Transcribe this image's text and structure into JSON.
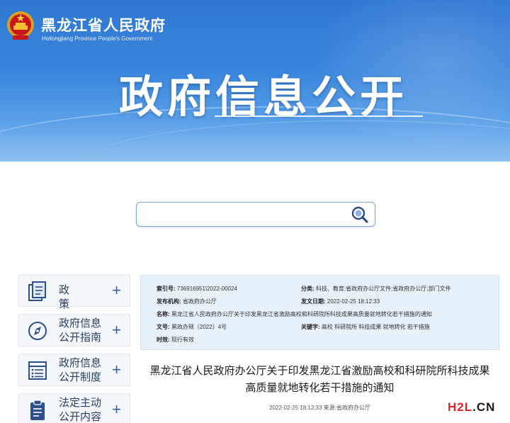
{
  "header": {
    "site_name": "黑龙江省人民政府",
    "site_name_en": "Heilongjiang Province People's Government",
    "banner_title": "政府信息公开"
  },
  "search": {
    "placeholder": "",
    "value": ""
  },
  "sidebar": {
    "items": [
      {
        "label": "政 策",
        "icon": "document-stack-icon"
      },
      {
        "label_line1": "政府信息",
        "label_line2": "公开指南",
        "icon": "compass-icon"
      },
      {
        "label_line1": "政府信息",
        "label_line2": "公开制度",
        "icon": "list-document-icon"
      },
      {
        "label_line1": "法定主动",
        "label_line2": "公开内容",
        "icon": "clipboard-icon"
      }
    ],
    "expand_symbol": "+"
  },
  "info": {
    "index_label": "索引号:",
    "index_value": "736916951\\2022-00024",
    "category_label": "分类:",
    "category_value": "科技、教育;省政府办公厅文件;省政府办公厅;部门文件",
    "publisher_label": "发布机构:",
    "publisher_value": "省政府办公厅",
    "date_label": "发文日期:",
    "date_value": "2022-02-25 18:12:33",
    "name_label": "名称:",
    "name_value": "黑龙江省人民政府办公厅关于印发黑龙江省激励高校和科研院所科技成果高质量就地转化若干措施的通知",
    "doc_no_label": "文号:",
    "doc_no_value": "黑政办规〔2022〕4号",
    "keywords_label": "关键字:",
    "keywords_value": "高校 科研院所 科技成果 就地转化 若干措施",
    "validity_label": "时效:",
    "validity_value": "现行有效"
  },
  "document": {
    "title_line1": "黑龙江省人民政府办公厅关于印发黑龙江省激励高校和科研院所科技成果",
    "title_line2": "高质量就地转化若干措施的通知",
    "meta": "2022-02-25 18:12:33 来源:省政府办公厅"
  },
  "watermark": {
    "part1": "H2L",
    "part2": ".CN"
  },
  "colors": {
    "banner": "#3a86dc",
    "nav_text": "#2b3f66",
    "info_bg": "#e6f1fa",
    "watermark_red": "#e0242b"
  }
}
